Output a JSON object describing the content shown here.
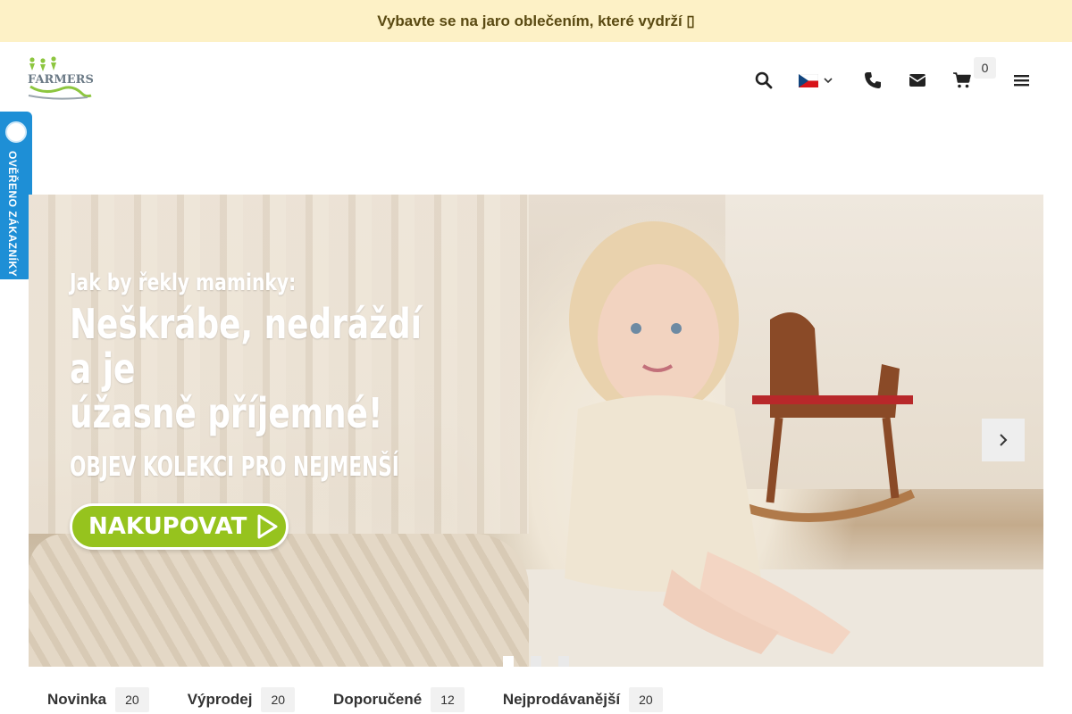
{
  "promo": {
    "text": "Vybavte se na jaro oblečením, které vydrží ▯"
  },
  "header": {
    "logo_alt": "FARMERS",
    "cart_count": "0",
    "icons": [
      "search-icon",
      "flag-cz-icon",
      "chevron-down-icon",
      "phone-icon",
      "mail-icon",
      "cart-icon",
      "menu-icon"
    ]
  },
  "verified": {
    "label": "OVĚŘENO ZÁKAZNÍKY"
  },
  "hero": {
    "line1": "Jak by řekly maminky:",
    "line2": "Neškrábe, nedráždí a je",
    "line3": "úžasně příjemné!",
    "line4": "OBJEV KOLEKCI PRO NEJMENŠÍ",
    "cta": "NAKUPOVAT"
  },
  "slider": {
    "dots": 3,
    "active": 0
  },
  "tabs": [
    {
      "label": "Novinka",
      "count": "20"
    },
    {
      "label": "Výprodej",
      "count": "20"
    },
    {
      "label": "Doporučené",
      "count": "12"
    },
    {
      "label": "Nejprodávanější",
      "count": "20"
    }
  ],
  "colors": {
    "promo_bg": "#fdf1c6",
    "verified_bg": "#1e8fd6",
    "cta_bg": "#96c31e",
    "brand_green": "#8dc63f"
  }
}
